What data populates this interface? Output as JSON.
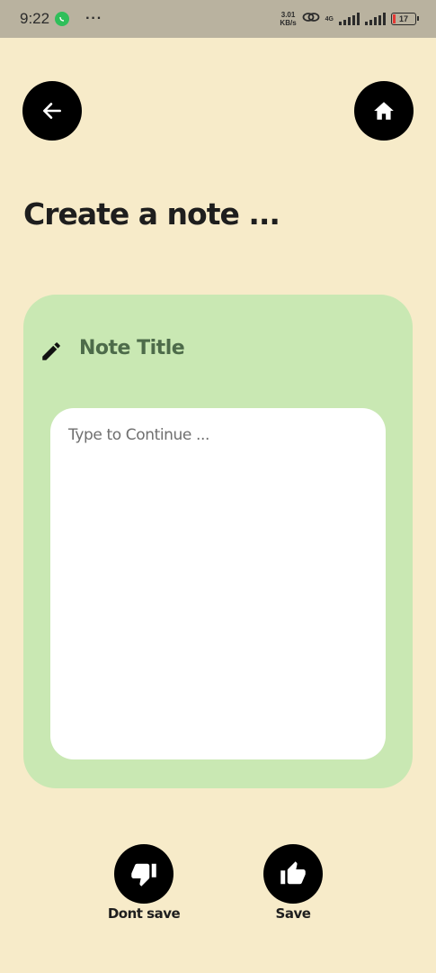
{
  "status_bar": {
    "time": "9:22",
    "more": "···",
    "speed_value": "3.01",
    "speed_unit": "KB/s",
    "network": "4G",
    "battery": "17"
  },
  "header": {
    "back_icon": "arrow-left",
    "home_icon": "home"
  },
  "page_title": "Create a note ...",
  "note": {
    "title_placeholder": "Note Title",
    "body_placeholder": "Type to Continue ..."
  },
  "actions": {
    "dont_save_label": "Dont save",
    "save_label": "Save"
  },
  "colors": {
    "background": "#f7ebc9",
    "card": "#c9e8b3",
    "button": "#000000"
  }
}
